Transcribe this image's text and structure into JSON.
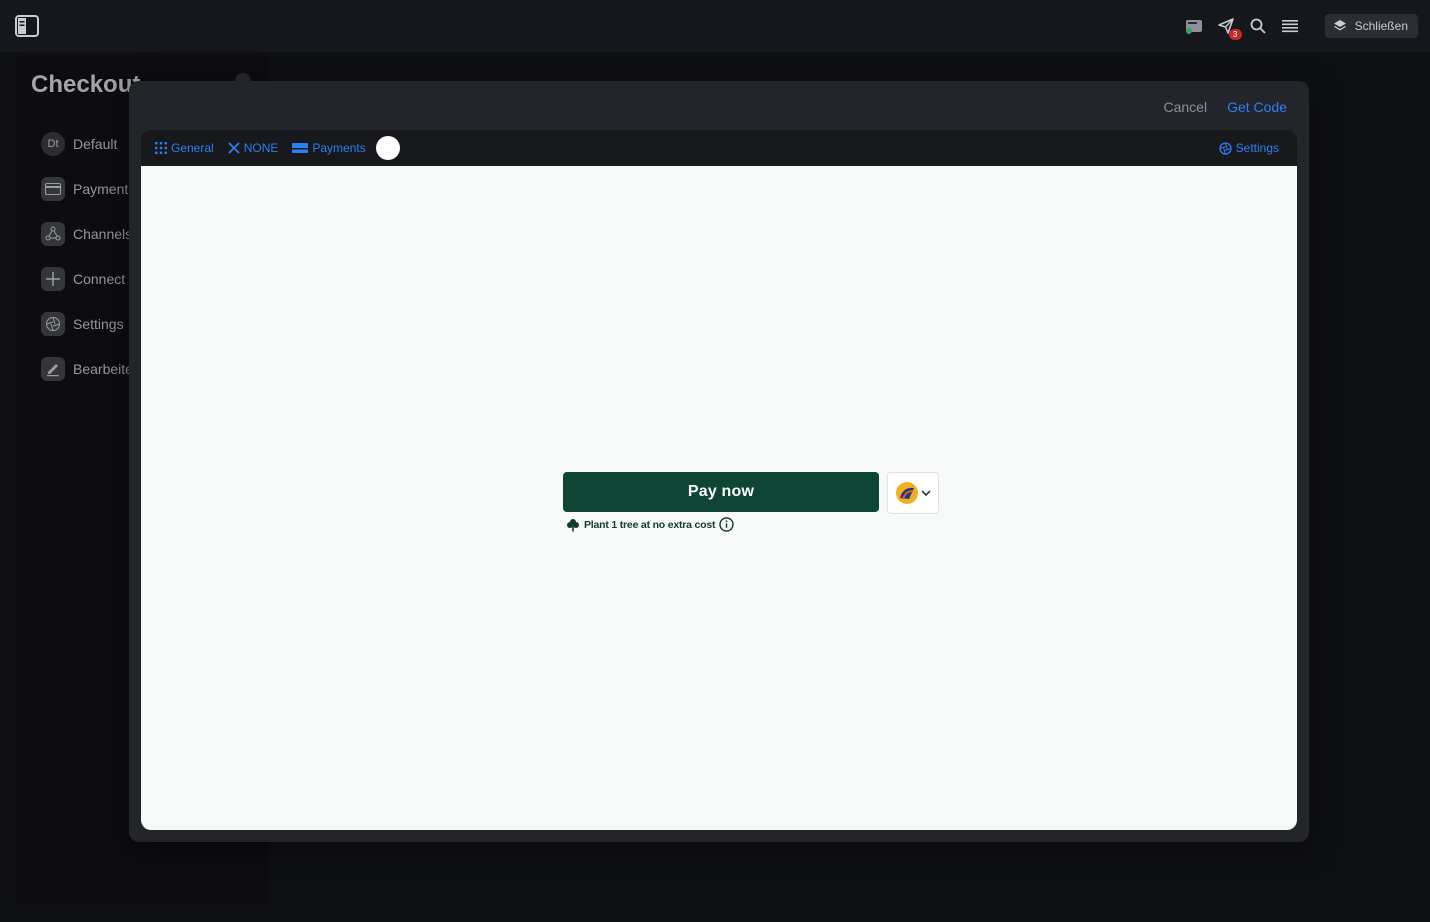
{
  "header": {
    "close_label": "Schließen",
    "notification_count": "3"
  },
  "panel": {
    "title": "Checkout",
    "items": [
      {
        "label": "Default",
        "icon": "avatar-dt",
        "avatar_text": "Dt"
      },
      {
        "label": "Payment",
        "icon": "card-icon"
      },
      {
        "label": "Channels",
        "icon": "share-icon"
      },
      {
        "label": "Connect",
        "icon": "plus-icon"
      },
      {
        "label": "Settings",
        "icon": "aperture-icon"
      },
      {
        "label": "Bearbeiten",
        "icon": "edit-icon"
      }
    ]
  },
  "modal": {
    "cancel_label": "Cancel",
    "get_code_label": "Get Code",
    "toolbar": {
      "general_label": "General",
      "none_label": "NONE",
      "payments_label": "Payments",
      "settings_label": "Settings"
    },
    "preview": {
      "pay_label": "Pay now",
      "tree_text": "Plant 1 tree at no extra cost"
    }
  },
  "colors": {
    "accent": "#2d7ff0",
    "pay_button": "#0f4534",
    "background": "#16171c",
    "badge": "#c62828"
  }
}
